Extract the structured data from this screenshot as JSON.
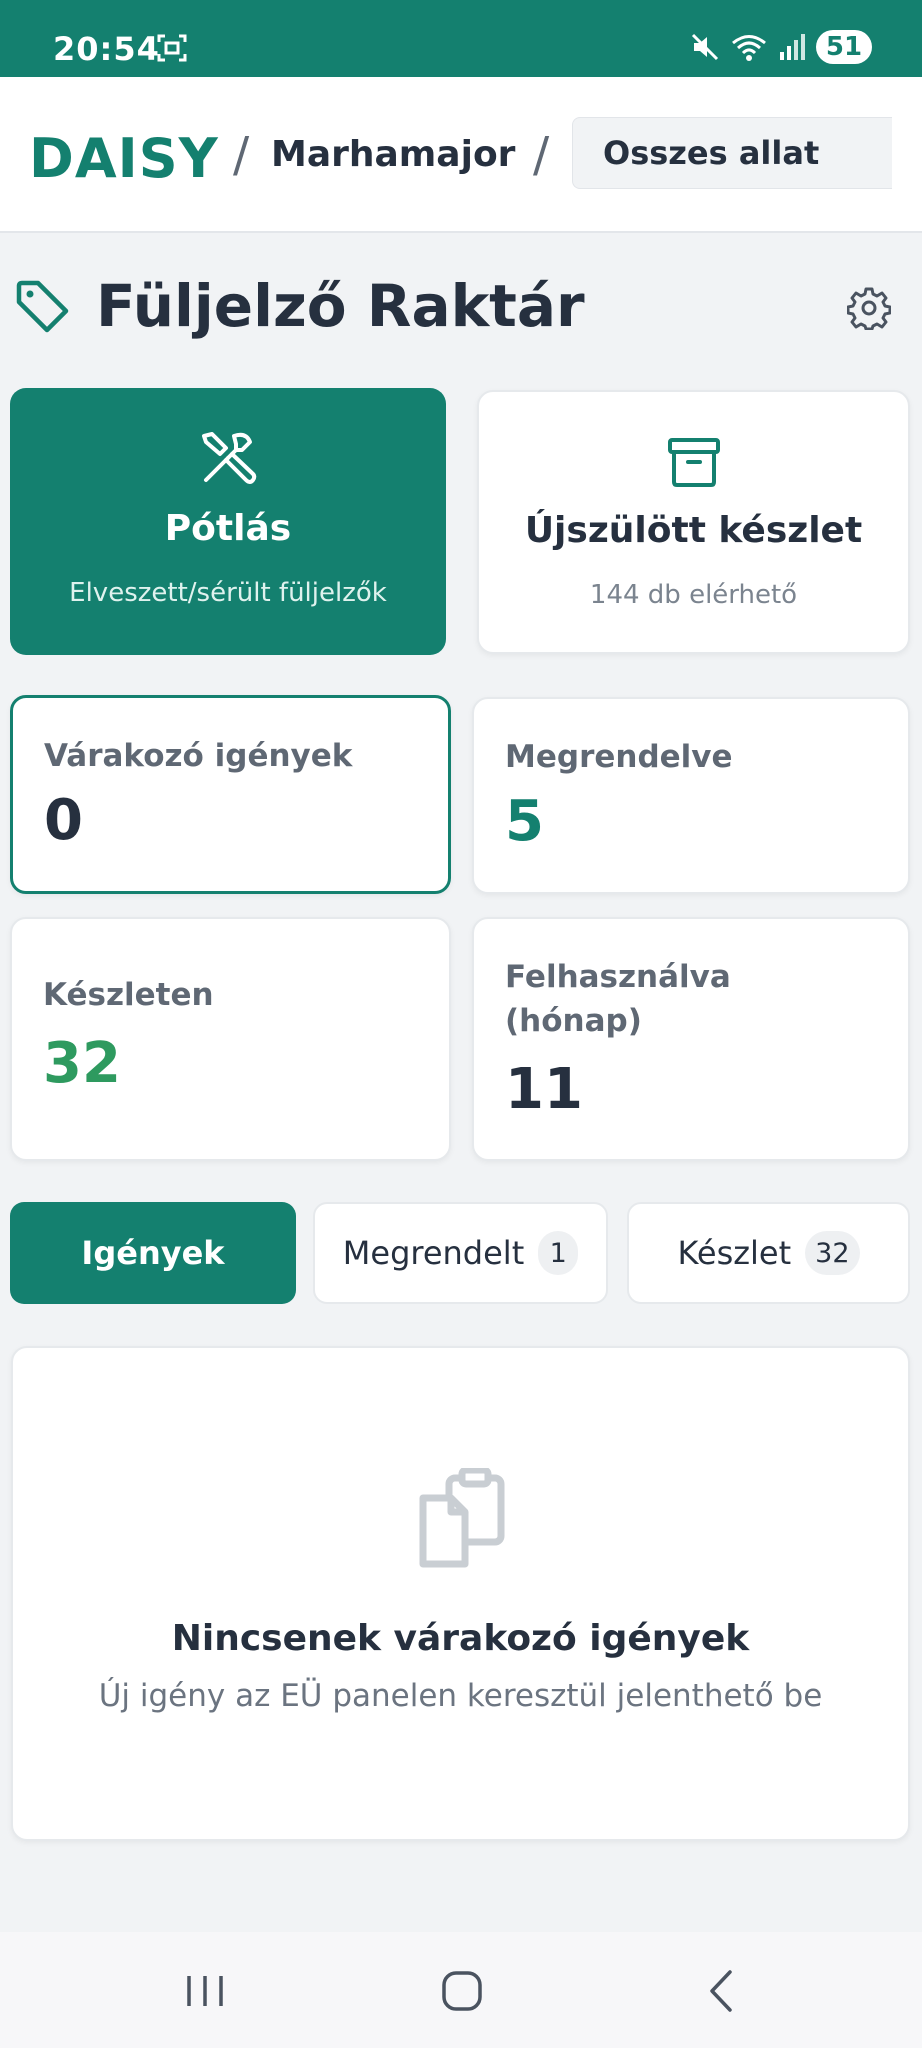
{
  "status_bar": {
    "time": "20:54",
    "battery": "51",
    "icons": [
      "screenshot-icon",
      "mute-icon",
      "wifi-icon",
      "signal-icon"
    ]
  },
  "header": {
    "brand": "DAISY",
    "separator": "/",
    "farm": "Marhamajor",
    "animal_filter": "Osszes allat"
  },
  "page": {
    "title": "Füljelző Raktár",
    "title_icon": "tag-icon",
    "settings_icon": "gear-icon"
  },
  "actions": {
    "replacement": {
      "title": "Pótlás",
      "subtitle": "Elveszett/sérült füljelzők",
      "icon": "tools-icon"
    },
    "newborn": {
      "title": "Újszülött készlet",
      "subtitle": "144 db elérhető",
      "icon": "archive-box-icon"
    }
  },
  "stats": {
    "pending": {
      "label": "Várakozó igények",
      "value": "0"
    },
    "ordered": {
      "label": "Megrendelve",
      "value": "5"
    },
    "in_stock": {
      "label": "Készleten",
      "value": "32"
    },
    "used": {
      "label": "Felhasználva (hónap)",
      "value": "11"
    }
  },
  "tabs": {
    "requests": {
      "label": "Igények"
    },
    "ordered": {
      "label": "Megrendelt",
      "count": "1"
    },
    "stock": {
      "label": "Készlet",
      "count": "32"
    }
  },
  "empty_state": {
    "icon": "clipboard-icon",
    "title": "Nincsenek várakozó igények",
    "subtitle": "Új igény az EÜ panelen keresztül jelenthető be"
  },
  "colors": {
    "primary": "#14806f",
    "success": "#2e9a5f",
    "text": "#26303f"
  }
}
